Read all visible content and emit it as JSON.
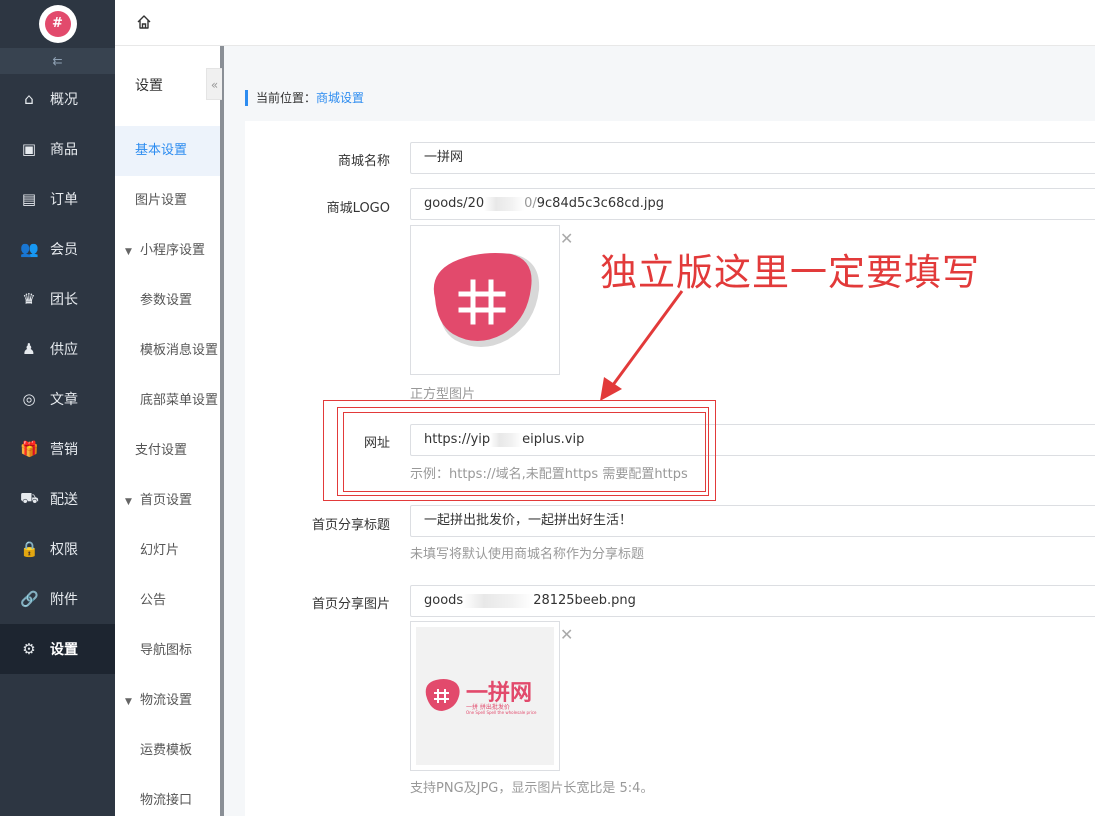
{
  "nav": {
    "items": [
      {
        "label": "概况",
        "icon": "home-icon",
        "glyph": "⌂"
      },
      {
        "label": "商品",
        "icon": "bag-icon",
        "glyph": "▣"
      },
      {
        "label": "订单",
        "icon": "document-icon",
        "glyph": "▤"
      },
      {
        "label": "会员",
        "icon": "users-icon",
        "glyph": "👥"
      },
      {
        "label": "团长",
        "icon": "crown-icon",
        "glyph": "♛"
      },
      {
        "label": "供应",
        "icon": "supplier-icon",
        "glyph": "♟"
      },
      {
        "label": "文章",
        "icon": "compass-icon",
        "glyph": "◎"
      },
      {
        "label": "营销",
        "icon": "gift-icon",
        "glyph": "🎁"
      },
      {
        "label": "配送",
        "icon": "truck-icon",
        "glyph": "⛟"
      },
      {
        "label": "权限",
        "icon": "lock-icon",
        "glyph": "🔒"
      },
      {
        "label": "附件",
        "icon": "link-icon",
        "glyph": "🔗"
      },
      {
        "label": "设置",
        "icon": "gear-icon",
        "glyph": "⚙"
      }
    ],
    "active_index": 11
  },
  "submenu": {
    "title": "设置",
    "rows": [
      {
        "label": "基本设置",
        "kind": "top",
        "active": true
      },
      {
        "label": "图片设置",
        "kind": "top"
      },
      {
        "label": "小程序设置",
        "kind": "group"
      },
      {
        "label": "参数设置",
        "kind": "child"
      },
      {
        "label": "模板消息设置",
        "kind": "child"
      },
      {
        "label": "底部菜单设置",
        "kind": "child"
      },
      {
        "label": "支付设置",
        "kind": "top"
      },
      {
        "label": "首页设置",
        "kind": "group"
      },
      {
        "label": "幻灯片",
        "kind": "child"
      },
      {
        "label": "公告",
        "kind": "child"
      },
      {
        "label": "导航图标",
        "kind": "child"
      },
      {
        "label": "物流设置",
        "kind": "group"
      },
      {
        "label": "运费模板",
        "kind": "child"
      },
      {
        "label": "物流接口",
        "kind": "child"
      }
    ]
  },
  "breadcrumb": {
    "prefix": "当前位置：",
    "current": "商城设置"
  },
  "form": {
    "shop_name": {
      "label": "商城名称",
      "value": "一拼网"
    },
    "shop_logo": {
      "label": "商城LOGO",
      "value_start": "goods/20",
      "value_mid": "0/",
      "value_end": "9c84d5c3c68cd.jpg",
      "hint": "正方型图片",
      "logo_glyph": "井"
    },
    "url": {
      "label": "网址",
      "value_start": "https://yip",
      "value_end": "eiplus.vip",
      "hint": "示例：https://域名,未配置https 需要配置https"
    },
    "share_title": {
      "label": "首页分享标题",
      "value": "一起拼出批发价，一起拼出好生活！",
      "hint": "未填写将默认使用商城名称作为分享标题"
    },
    "share_image": {
      "label": "首页分享图片",
      "value_start": "goods",
      "value_end": "28125beeb.png",
      "hint": "支持PNG及JPG，显示图片长宽比是 5:4。",
      "brand_text": "一拼网",
      "brand_slogan": "一拼    拼出批发价",
      "brand_slogan_en": "One Spell  Spell the wholesale price",
      "logo_glyph": "井"
    }
  },
  "annotation": {
    "text": "独立版这里一定要填写",
    "color": "#e23a3a"
  },
  "colors": {
    "accent": "#2d8cf0",
    "sidebar": "#2d3642",
    "brand": "#e24a6c"
  }
}
